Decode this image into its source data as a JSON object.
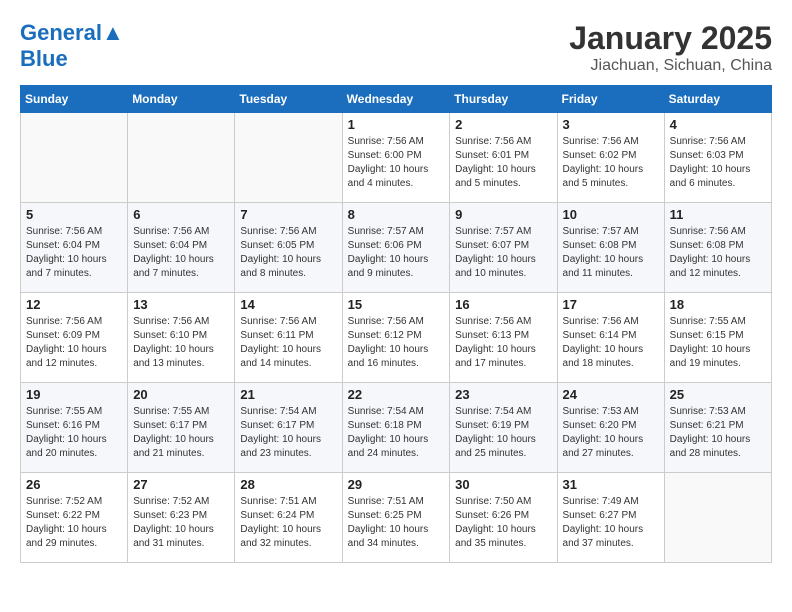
{
  "header": {
    "logo_general": "General",
    "logo_blue": "Blue",
    "title": "January 2025",
    "subtitle": "Jiachuan, Sichuan, China"
  },
  "weekdays": [
    "Sunday",
    "Monday",
    "Tuesday",
    "Wednesday",
    "Thursday",
    "Friday",
    "Saturday"
  ],
  "weeks": [
    [
      {
        "day": "",
        "info": ""
      },
      {
        "day": "",
        "info": ""
      },
      {
        "day": "",
        "info": ""
      },
      {
        "day": "1",
        "info": "Sunrise: 7:56 AM\nSunset: 6:00 PM\nDaylight: 10 hours\nand 4 minutes."
      },
      {
        "day": "2",
        "info": "Sunrise: 7:56 AM\nSunset: 6:01 PM\nDaylight: 10 hours\nand 5 minutes."
      },
      {
        "day": "3",
        "info": "Sunrise: 7:56 AM\nSunset: 6:02 PM\nDaylight: 10 hours\nand 5 minutes."
      },
      {
        "day": "4",
        "info": "Sunrise: 7:56 AM\nSunset: 6:03 PM\nDaylight: 10 hours\nand 6 minutes."
      }
    ],
    [
      {
        "day": "5",
        "info": "Sunrise: 7:56 AM\nSunset: 6:04 PM\nDaylight: 10 hours\nand 7 minutes."
      },
      {
        "day": "6",
        "info": "Sunrise: 7:56 AM\nSunset: 6:04 PM\nDaylight: 10 hours\nand 7 minutes."
      },
      {
        "day": "7",
        "info": "Sunrise: 7:56 AM\nSunset: 6:05 PM\nDaylight: 10 hours\nand 8 minutes."
      },
      {
        "day": "8",
        "info": "Sunrise: 7:57 AM\nSunset: 6:06 PM\nDaylight: 10 hours\nand 9 minutes."
      },
      {
        "day": "9",
        "info": "Sunrise: 7:57 AM\nSunset: 6:07 PM\nDaylight: 10 hours\nand 10 minutes."
      },
      {
        "day": "10",
        "info": "Sunrise: 7:57 AM\nSunset: 6:08 PM\nDaylight: 10 hours\nand 11 minutes."
      },
      {
        "day": "11",
        "info": "Sunrise: 7:56 AM\nSunset: 6:08 PM\nDaylight: 10 hours\nand 12 minutes."
      }
    ],
    [
      {
        "day": "12",
        "info": "Sunrise: 7:56 AM\nSunset: 6:09 PM\nDaylight: 10 hours\nand 12 minutes."
      },
      {
        "day": "13",
        "info": "Sunrise: 7:56 AM\nSunset: 6:10 PM\nDaylight: 10 hours\nand 13 minutes."
      },
      {
        "day": "14",
        "info": "Sunrise: 7:56 AM\nSunset: 6:11 PM\nDaylight: 10 hours\nand 14 minutes."
      },
      {
        "day": "15",
        "info": "Sunrise: 7:56 AM\nSunset: 6:12 PM\nDaylight: 10 hours\nand 16 minutes."
      },
      {
        "day": "16",
        "info": "Sunrise: 7:56 AM\nSunset: 6:13 PM\nDaylight: 10 hours\nand 17 minutes."
      },
      {
        "day": "17",
        "info": "Sunrise: 7:56 AM\nSunset: 6:14 PM\nDaylight: 10 hours\nand 18 minutes."
      },
      {
        "day": "18",
        "info": "Sunrise: 7:55 AM\nSunset: 6:15 PM\nDaylight: 10 hours\nand 19 minutes."
      }
    ],
    [
      {
        "day": "19",
        "info": "Sunrise: 7:55 AM\nSunset: 6:16 PM\nDaylight: 10 hours\nand 20 minutes."
      },
      {
        "day": "20",
        "info": "Sunrise: 7:55 AM\nSunset: 6:17 PM\nDaylight: 10 hours\nand 21 minutes."
      },
      {
        "day": "21",
        "info": "Sunrise: 7:54 AM\nSunset: 6:17 PM\nDaylight: 10 hours\nand 23 minutes."
      },
      {
        "day": "22",
        "info": "Sunrise: 7:54 AM\nSunset: 6:18 PM\nDaylight: 10 hours\nand 24 minutes."
      },
      {
        "day": "23",
        "info": "Sunrise: 7:54 AM\nSunset: 6:19 PM\nDaylight: 10 hours\nand 25 minutes."
      },
      {
        "day": "24",
        "info": "Sunrise: 7:53 AM\nSunset: 6:20 PM\nDaylight: 10 hours\nand 27 minutes."
      },
      {
        "day": "25",
        "info": "Sunrise: 7:53 AM\nSunset: 6:21 PM\nDaylight: 10 hours\nand 28 minutes."
      }
    ],
    [
      {
        "day": "26",
        "info": "Sunrise: 7:52 AM\nSunset: 6:22 PM\nDaylight: 10 hours\nand 29 minutes."
      },
      {
        "day": "27",
        "info": "Sunrise: 7:52 AM\nSunset: 6:23 PM\nDaylight: 10 hours\nand 31 minutes."
      },
      {
        "day": "28",
        "info": "Sunrise: 7:51 AM\nSunset: 6:24 PM\nDaylight: 10 hours\nand 32 minutes."
      },
      {
        "day": "29",
        "info": "Sunrise: 7:51 AM\nSunset: 6:25 PM\nDaylight: 10 hours\nand 34 minutes."
      },
      {
        "day": "30",
        "info": "Sunrise: 7:50 AM\nSunset: 6:26 PM\nDaylight: 10 hours\nand 35 minutes."
      },
      {
        "day": "31",
        "info": "Sunrise: 7:49 AM\nSunset: 6:27 PM\nDaylight: 10 hours\nand 37 minutes."
      },
      {
        "day": "",
        "info": ""
      }
    ]
  ]
}
